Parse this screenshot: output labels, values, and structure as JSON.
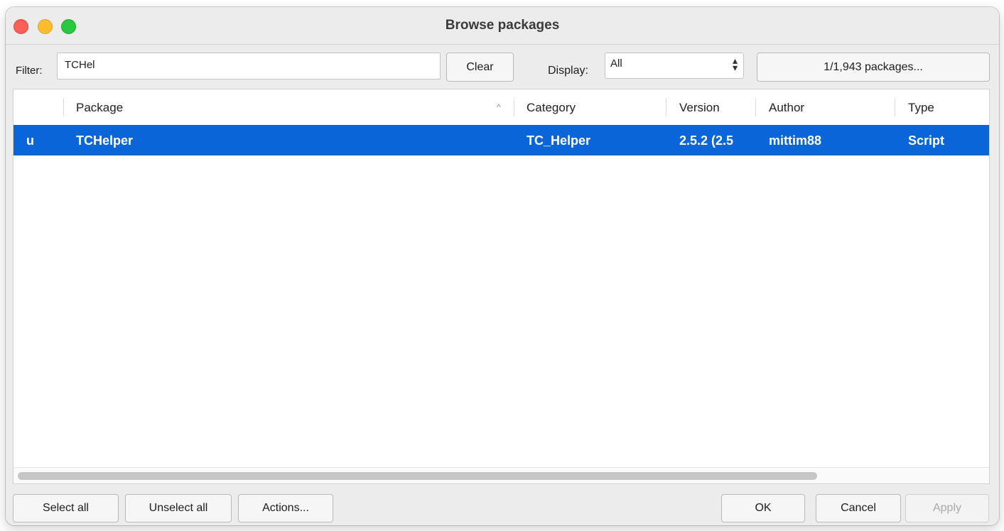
{
  "window": {
    "title": "Browse packages"
  },
  "toolbar": {
    "filter_label": "Filter:",
    "filter_value": "TCHel",
    "clear_label": "Clear",
    "display_label": "Display:",
    "display_value": "All",
    "packages_label": "1/1,943 packages..."
  },
  "table": {
    "columns": [
      "",
      "Package",
      "Category",
      "Version",
      "Author",
      "Type"
    ],
    "rows": [
      {
        "status": "u",
        "package": "TCHelper",
        "category": "TC_Helper",
        "version": "2.5.2 (2.5",
        "author": "mittim88",
        "type": "Script",
        "selected": true
      }
    ]
  },
  "footer": {
    "select_all": "Select all",
    "unselect_all": "Unselect all",
    "actions": "Actions...",
    "ok": "OK",
    "cancel": "Cancel",
    "apply": "Apply"
  },
  "colors": {
    "selection": "#0a65d9",
    "close": "#fe5f57",
    "minimize": "#febc2e",
    "maximize": "#28c840"
  }
}
